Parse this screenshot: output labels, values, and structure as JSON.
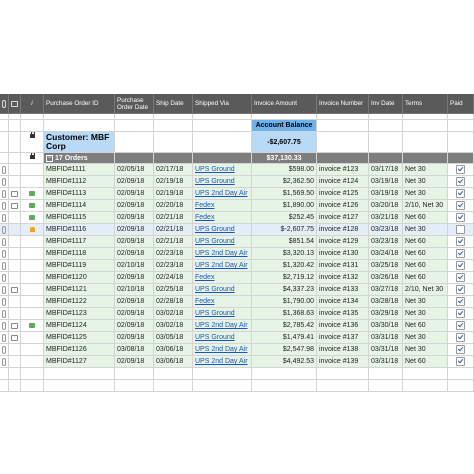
{
  "columns": {
    "po_id": "Purchase Order ID",
    "order_date": "Purchase Order Date",
    "ship_date": "Ship Date",
    "shipped_via": "Shipped Via",
    "invoice_amount": "Invoice Amount",
    "invoice_number": "Invoice Number",
    "inv_date": "Inv Date",
    "terms": "Terms",
    "paid": "Paid"
  },
  "customer": {
    "label": "Customer: MBF Corp"
  },
  "account_balance": {
    "label": "Account Balance",
    "value": "-$2,607.75"
  },
  "group": {
    "label": "17 Orders",
    "total": "$37,130.33"
  },
  "orders": [
    {
      "id": "MBFID#1111",
      "order_date": "02/05/18",
      "ship_date": "02/17/18",
      "via": "UPS Ground",
      "amount": "$598.00",
      "invoice": "invoice #123",
      "inv_date": "03/17/18",
      "terms": "Net 30",
      "paid": true
    },
    {
      "id": "MBFID#1112",
      "order_date": "02/09/18",
      "ship_date": "02/19/18",
      "via": "UPS Ground",
      "amount": "$2,362.50",
      "invoice": "invoice #124",
      "inv_date": "03/19/18",
      "terms": "Net 30",
      "paid": true
    },
    {
      "id": "MBFID#1113",
      "order_date": "02/09/18",
      "ship_date": "02/19/18",
      "via": "UPS 2nd Day Air",
      "amount": "$1,569.50",
      "invoice": "invoice #125",
      "inv_date": "03/19/18",
      "terms": "Net 30",
      "paid": true
    },
    {
      "id": "MBFID#1114",
      "order_date": "02/09/18",
      "ship_date": "02/20/18",
      "via": "Fedex",
      "amount": "$1,890.00",
      "invoice": "invoice #126",
      "inv_date": "03/20/18",
      "terms": "2/10, Net 30",
      "paid": true
    },
    {
      "id": "MBFID#1115",
      "order_date": "02/09/18",
      "ship_date": "02/21/18",
      "via": "Fedex",
      "amount": "$252.45",
      "invoice": "invoice #127",
      "inv_date": "03/21/18",
      "terms": "Net 60",
      "paid": true
    },
    {
      "id": "MBFID#1116",
      "order_date": "02/09/18",
      "ship_date": "02/21/18",
      "via": "UPS Ground",
      "amount": "$-2,607.75",
      "invoice": "invoice #128",
      "inv_date": "03/23/18",
      "terms": "Net 30",
      "paid": false
    },
    {
      "id": "MBFID#1117",
      "order_date": "02/09/18",
      "ship_date": "02/21/18",
      "via": "UPS Ground",
      "amount": "$851.54",
      "invoice": "invoice #129",
      "inv_date": "03/23/18",
      "terms": "Net 60",
      "paid": true
    },
    {
      "id": "MBFID#1118",
      "order_date": "02/09/18",
      "ship_date": "02/23/18",
      "via": "UPS 2nd Day Air",
      "amount": "$3,320.13",
      "invoice": "invoice #130",
      "inv_date": "03/24/18",
      "terms": "Net 60",
      "paid": true
    },
    {
      "id": "MBFID#1119",
      "order_date": "02/10/18",
      "ship_date": "02/23/18",
      "via": "UPS 2nd Day Air",
      "amount": "$1,320.42",
      "invoice": "invoice #131",
      "inv_date": "03/25/18",
      "terms": "Net 60",
      "paid": true
    },
    {
      "id": "MBFID#1120",
      "order_date": "02/09/18",
      "ship_date": "02/24/18",
      "via": "Fedex",
      "amount": "$2,719.12",
      "invoice": "invoice #132",
      "inv_date": "03/26/18",
      "terms": "Net 60",
      "paid": true
    },
    {
      "id": "MBFID#1121",
      "order_date": "02/10/18",
      "ship_date": "02/25/18",
      "via": "UPS Ground",
      "amount": "$4,337.23",
      "invoice": "invoice #133",
      "inv_date": "03/27/18",
      "terms": "2/10, Net 30",
      "paid": true
    },
    {
      "id": "MBFID#1122",
      "order_date": "02/09/18",
      "ship_date": "02/28/18",
      "via": "Fedex",
      "amount": "$1,790.00",
      "invoice": "invoice #134",
      "inv_date": "03/28/18",
      "terms": "Net 30",
      "paid": true
    },
    {
      "id": "MBFID#1123",
      "order_date": "02/09/18",
      "ship_date": "03/02/18",
      "via": "UPS Ground",
      "amount": "$1,368.63",
      "invoice": "invoice #135",
      "inv_date": "03/29/18",
      "terms": "Net 30",
      "paid": true
    },
    {
      "id": "MBFID#1124",
      "order_date": "02/09/18",
      "ship_date": "03/02/18",
      "via": "UPS 2nd Day Air",
      "amount": "$2,785.42",
      "invoice": "invoice #136",
      "inv_date": "03/30/18",
      "terms": "Net 60",
      "paid": true
    },
    {
      "id": "MBFID#1125",
      "order_date": "02/09/18",
      "ship_date": "03/05/18",
      "via": "UPS Ground",
      "amount": "$1,479.41",
      "invoice": "invoice #137",
      "inv_date": "03/31/18",
      "terms": "Net 30",
      "paid": true
    },
    {
      "id": "MBFID#1126",
      "order_date": "03/08/18",
      "ship_date": "03/06/18",
      "via": "UPS 2nd Day Air",
      "amount": "$2,547.98",
      "invoice": "invoice #138",
      "inv_date": "03/31/18",
      "terms": "Net 30",
      "paid": true
    },
    {
      "id": "MBFID#1127",
      "order_date": "02/09/18",
      "ship_date": "03/06/18",
      "via": "UPS 2nd Day Air",
      "amount": "$4,492.53",
      "invoice": "invoice #139",
      "inv_date": "03/31/18",
      "terms": "Net 60",
      "paid": true
    }
  ]
}
